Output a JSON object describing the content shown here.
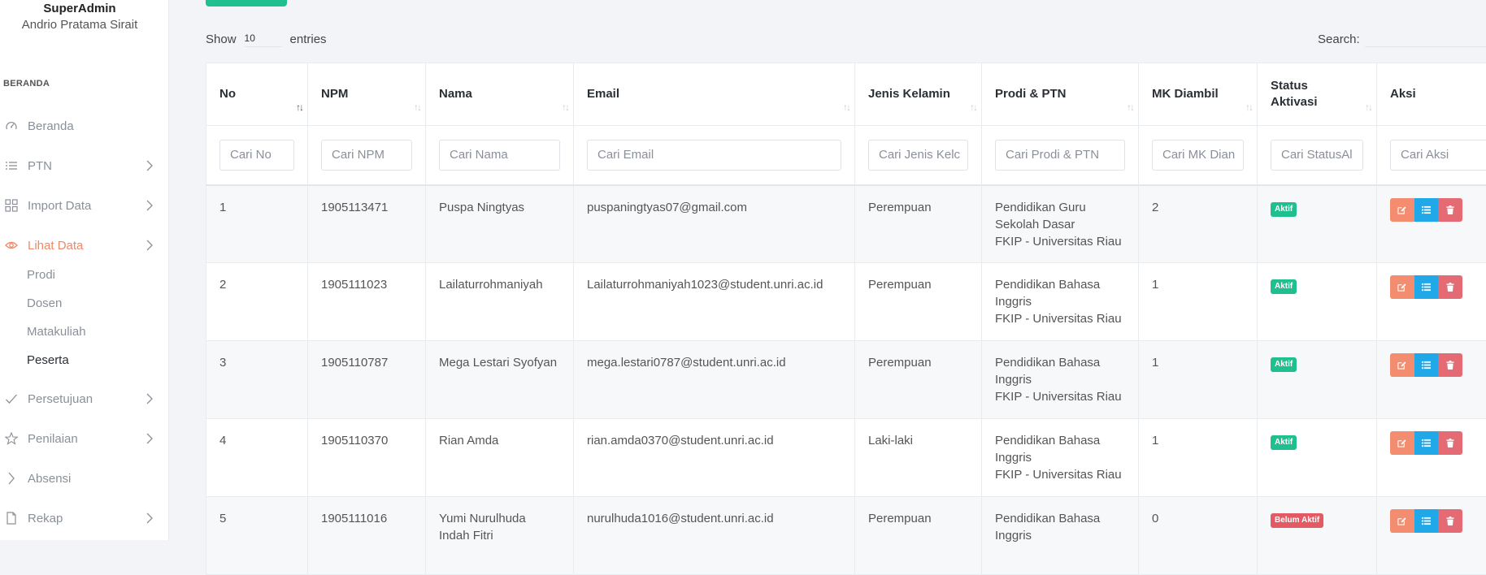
{
  "sidebar": {
    "user_role": "SuperAdmin",
    "user_name": "Andrio Pratama Sirait",
    "section_label": "BERANDA",
    "items": [
      {
        "label": "Beranda",
        "icon": "dashboard-icon",
        "has_chevron": false
      },
      {
        "label": "PTN",
        "icon": "list-icon",
        "has_chevron": true
      },
      {
        "label": "Import Data",
        "icon": "grid-icon",
        "has_chevron": true
      },
      {
        "label": "Lihat Data",
        "icon": "eye-icon",
        "has_chevron": true,
        "active": true
      },
      {
        "label": "Persetujuan",
        "icon": "check-icon",
        "has_chevron": true
      },
      {
        "label": "Penilaian",
        "icon": "star-icon",
        "has_chevron": true
      },
      {
        "label": "Absensi",
        "icon": "chevron-right-icon",
        "has_chevron": false
      },
      {
        "label": "Rekap",
        "icon": "file-icon",
        "has_chevron": true
      }
    ],
    "sub_items": [
      {
        "label": "Prodi"
      },
      {
        "label": "Dosen"
      },
      {
        "label": "Matakuliah"
      },
      {
        "label": "Peserta",
        "current": true
      }
    ]
  },
  "controls": {
    "show_label": "Show",
    "entries_value": "10",
    "entries_label": "entries",
    "search_label": "Search:"
  },
  "table": {
    "columns": [
      {
        "label": "No",
        "filter_placeholder": "Cari No"
      },
      {
        "label": "NPM",
        "filter_placeholder": "Cari NPM"
      },
      {
        "label": "Nama",
        "filter_placeholder": "Cari Nama"
      },
      {
        "label": "Email",
        "filter_placeholder": "Cari Email"
      },
      {
        "label": "Jenis Kelamin",
        "filter_placeholder": "Cari Jenis Kelc"
      },
      {
        "label": "Prodi & PTN",
        "filter_placeholder": "Cari Prodi & PTN"
      },
      {
        "label": "MK Diambil",
        "filter_placeholder": "Cari MK Dian"
      },
      {
        "label_line1": "Status",
        "label_line2": "Aktivasi",
        "filter_placeholder": "Cari StatusAl"
      },
      {
        "label": "Aksi",
        "filter_placeholder": "Cari Aksi"
      }
    ],
    "rows": [
      {
        "no": "1",
        "npm": "1905113471",
        "nama": "Puspa Ningtyas",
        "email": "puspaningtyas07@gmail.com",
        "jk": "Perempuan",
        "prodi_line1": "Pendidikan Guru",
        "prodi_line2": "Sekolah Dasar",
        "prodi_line3": "FKIP - Universitas Riau",
        "mk": "2",
        "status": "Aktif"
      },
      {
        "no": "2",
        "npm": "1905111023",
        "nama": "Lailaturrohmaniyah",
        "email": "Lailaturrohmaniyah1023@student.unri.ac.id",
        "jk": "Perempuan",
        "prodi_line1": "Pendidikan Bahasa",
        "prodi_line2": "Inggris",
        "prodi_line3": "FKIP - Universitas Riau",
        "mk": "1",
        "status": "Aktif"
      },
      {
        "no": "3",
        "npm": "1905110787",
        "nama": "Mega Lestari Syofyan",
        "email": "mega.lestari0787@student.unri.ac.id",
        "jk": "Perempuan",
        "prodi_line1": "Pendidikan Bahasa",
        "prodi_line2": "Inggris",
        "prodi_line3": "FKIP - Universitas Riau",
        "mk": "1",
        "status": "Aktif"
      },
      {
        "no": "4",
        "npm": "1905110370",
        "nama": "Rian Amda",
        "email": "rian.amda0370@student.unri.ac.id",
        "jk": "Laki-laki",
        "prodi_line1": "Pendidikan Bahasa",
        "prodi_line2": "Inggris",
        "prodi_line3": "FKIP - Universitas Riau",
        "mk": "1",
        "status": "Aktif"
      },
      {
        "no": "5",
        "npm": "1905111016",
        "nama_line1": "Yumi Nurulhuda",
        "nama_line2": "Indah Fitri",
        "email": "nurulhuda1016@student.unri.ac.id",
        "jk": "Perempuan",
        "prodi_line1": "Pendidikan Bahasa",
        "prodi_line2": "Inggris",
        "prodi_line3": "",
        "mk": "0",
        "status": "Belum Aktif"
      }
    ]
  },
  "colors": {
    "accent": "#f0886a",
    "status_active": "#1fbf8f",
    "status_inactive": "#e45a64",
    "action_edit": "#f48c6f",
    "action_list": "#20a8e8",
    "action_delete": "#e46a73"
  }
}
